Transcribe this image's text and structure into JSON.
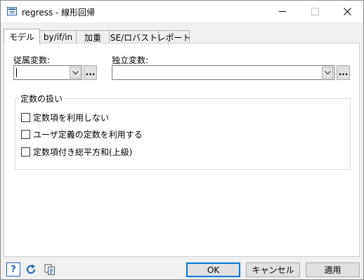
{
  "window": {
    "title": "regress - 線形回帰",
    "icons": {
      "app": "dialog-icon",
      "minimize": "minimize-icon",
      "maximize": "maximize-icon",
      "close": "close-icon"
    }
  },
  "tabs": [
    {
      "label": "モデル",
      "active": true
    },
    {
      "label": "by/if/in",
      "active": false
    },
    {
      "label": "加重",
      "active": false
    },
    {
      "label": "SE/ロバスト",
      "active": false
    },
    {
      "label": "レポート",
      "active": false
    }
  ],
  "model": {
    "dependent": {
      "label": "従属変数:",
      "value": "",
      "browse_label": "..."
    },
    "independent": {
      "label": "独立変数:",
      "value": "",
      "browse_label": "..."
    },
    "constant_group": {
      "title": "定数の扱い",
      "options": [
        {
          "label": "定数項を利用しない",
          "checked": false
        },
        {
          "label": "ユーザ定義の定数を利用する",
          "checked": false
        },
        {
          "label": "定数項付き総平方和(上級)",
          "checked": false
        }
      ]
    }
  },
  "footer": {
    "icons": {
      "help": "help-icon",
      "reset": "reset-icon",
      "copy": "copy-command-icon"
    },
    "help_glyph": "?",
    "ok_label": "OK",
    "cancel_label": "キャンセル",
    "apply_label": "適用"
  },
  "colors": {
    "accent": "#0078d7",
    "panel": "#ffffff",
    "chrome": "#f0f0f0",
    "icon_blue": "#2b63b5"
  }
}
